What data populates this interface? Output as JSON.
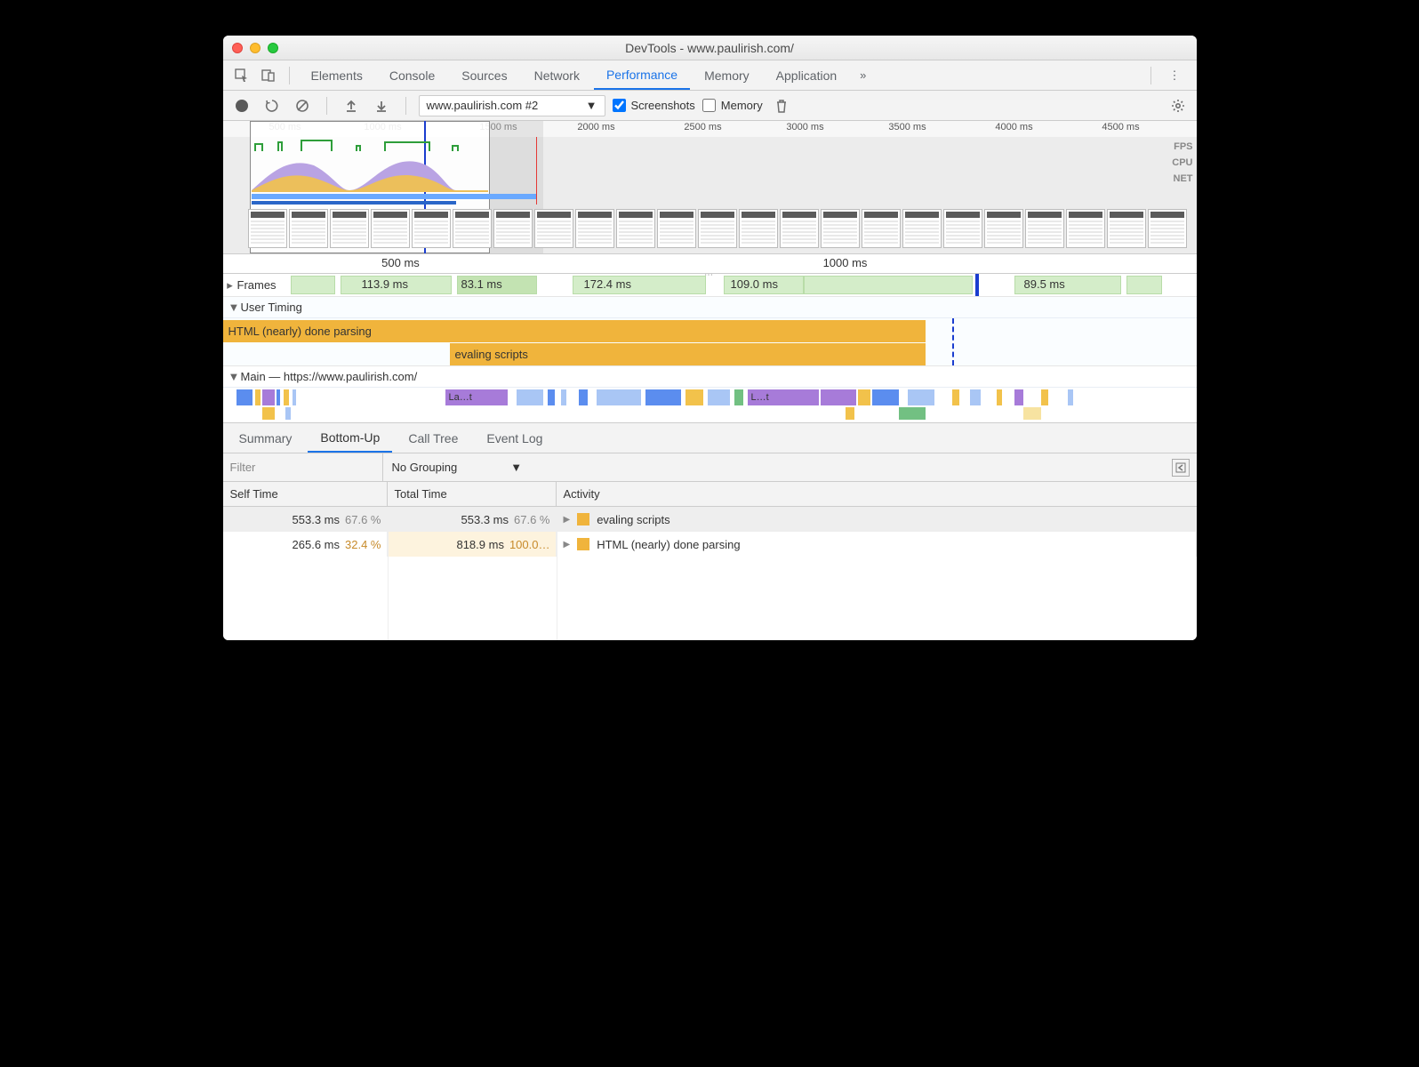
{
  "window": {
    "title": "DevTools - www.paulirish.com/"
  },
  "tabs": {
    "items": [
      "Elements",
      "Console",
      "Sources",
      "Network",
      "Performance",
      "Memory",
      "Application"
    ],
    "active": "Performance",
    "overflow": "»"
  },
  "toolbar": {
    "recording_select": "www.paulirish.com #2",
    "screenshots_label": "Screenshots",
    "screenshots_checked": true,
    "memory_label": "Memory",
    "memory_checked": false
  },
  "overview": {
    "ticks": [
      "500 ms",
      "1000 ms",
      "1500 ms",
      "2000 ms",
      "2500 ms",
      "3000 ms",
      "3500 ms",
      "4000 ms",
      "4500 ms"
    ],
    "lane_labels": [
      "FPS",
      "CPU",
      "NET"
    ]
  },
  "ruler": {
    "ticks": [
      "500 ms",
      "1000 ms"
    ]
  },
  "frames": {
    "label": "Frames",
    "values": [
      "113.9 ms",
      "83.1 ms",
      "172.4 ms",
      "109.0 ms",
      "89.5 ms"
    ]
  },
  "user_timing": {
    "label": "User Timing",
    "bars": [
      {
        "name": "HTML (nearly) done parsing"
      },
      {
        "name": "evaling scripts"
      }
    ]
  },
  "main": {
    "label": "Main — https://www.paulirish.com/",
    "slice_labels": [
      "La…t",
      "L…t"
    ]
  },
  "detail_tabs": {
    "items": [
      "Summary",
      "Bottom-Up",
      "Call Tree",
      "Event Log"
    ],
    "active": "Bottom-Up"
  },
  "filter": {
    "placeholder": "Filter",
    "grouping": "No Grouping"
  },
  "table": {
    "columns": [
      "Self Time",
      "Total Time",
      "Activity"
    ],
    "rows": [
      {
        "self_ms": "553.3 ms",
        "self_pct": "67.6 %",
        "total_ms": "553.3 ms",
        "total_pct": "67.6 %",
        "activity": "evaling scripts",
        "selected": true
      },
      {
        "self_ms": "265.6 ms",
        "self_pct": "32.4 %",
        "total_ms": "818.9 ms",
        "total_pct": "100.0…",
        "activity": "HTML (nearly) done parsing",
        "selected": false
      }
    ]
  }
}
